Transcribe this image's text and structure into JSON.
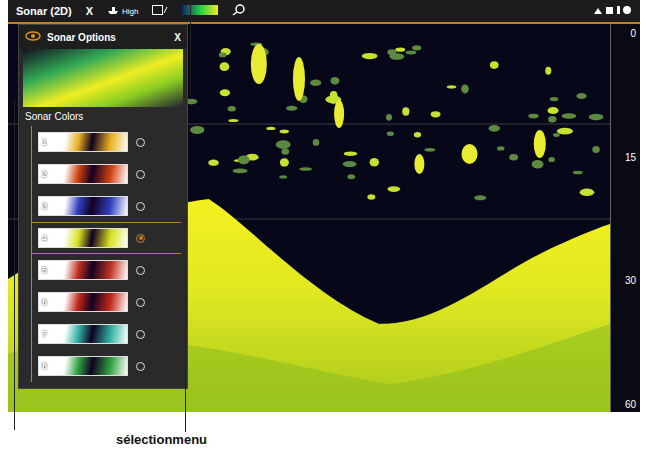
{
  "topbar": {
    "title": "Sonar (2D)",
    "close": "X",
    "mode": "High"
  },
  "options": {
    "title": "Sonar Options",
    "close": "X",
    "section": "Sonar Colors",
    "palettes": [
      {
        "label": "1",
        "selected": false,
        "color": "#e8b020"
      },
      {
        "label": "2",
        "selected": false,
        "color": "#d04010"
      },
      {
        "label": "3",
        "selected": false,
        "color": "#3040c0"
      },
      {
        "label": "4",
        "selected": true,
        "color": "#d8e020"
      },
      {
        "label": "5",
        "selected": false,
        "color": "#c03020"
      },
      {
        "label": "6",
        "selected": false,
        "color": "#c02818"
      },
      {
        "label": "7",
        "selected": false,
        "color": "#30b0a0"
      },
      {
        "label": "8",
        "selected": false,
        "color": "#30a040"
      }
    ]
  },
  "depth_scale": [
    "0",
    "15",
    "30",
    "60"
  ],
  "caption": "sélectionmenu"
}
